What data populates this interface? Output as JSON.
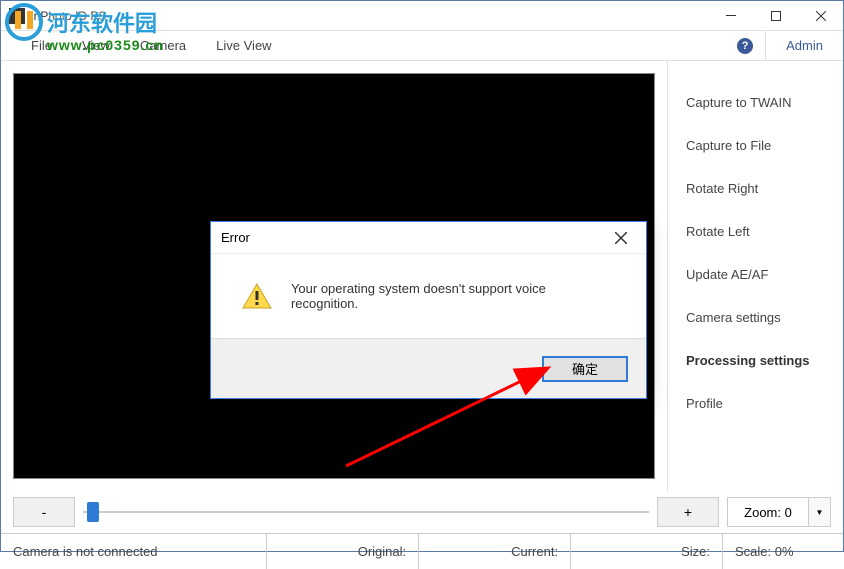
{
  "window": {
    "title": "inPhoto ID PS"
  },
  "menu": {
    "file": "File",
    "view": "View",
    "camera": "Camera",
    "live_view": "Live View",
    "admin": "Admin"
  },
  "sidebar": {
    "items": [
      {
        "label": "Capture to TWAIN"
      },
      {
        "label": "Capture to File"
      },
      {
        "label": "Rotate Right"
      },
      {
        "label": "Rotate Left"
      },
      {
        "label": "Update AE/AF"
      },
      {
        "label": "Camera settings"
      },
      {
        "label": "Processing settings"
      },
      {
        "label": "Profile"
      }
    ]
  },
  "zoom": {
    "minus": "-",
    "plus": "+",
    "label": "Zoom: 0",
    "dropdown": "▼"
  },
  "status": {
    "connection": "Camera is not connected",
    "original": "Original:",
    "current": "Current:",
    "size": "Size:",
    "scale": "Scale: 0%"
  },
  "dialog": {
    "title": "Error",
    "message": "Your operating system doesn't support voice recognition.",
    "ok": "确定"
  },
  "watermark": {
    "text": "河东软件园",
    "url": "www.pc0359.cn"
  }
}
